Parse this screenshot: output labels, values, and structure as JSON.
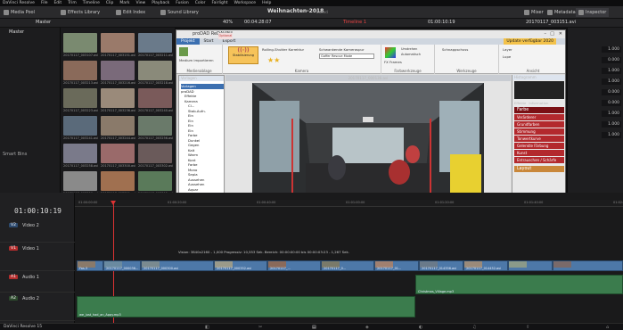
{
  "menubar": {
    "items": [
      "DaVinci Resolve",
      "File",
      "Edit",
      "Trim",
      "Timeline",
      "Clip",
      "Mark",
      "View",
      "Playback",
      "Fusion",
      "Color",
      "Fairlight",
      "Workspace",
      "Help"
    ]
  },
  "toolbar": {
    "media_pool": "Media Pool",
    "effects_library": "Effects Library",
    "edit_index": "Edit Index",
    "sound_library": "Sound Library",
    "project_title": "Weihnachten-2018",
    "edited": "Edited",
    "mixer": "Mixer",
    "metadata": "Metadata",
    "inspector": "Inspector"
  },
  "bar2": {
    "bin": "Master",
    "zoom": "40%",
    "src_tc": "00:04:28:07",
    "timeline_name": "Timeline 1",
    "rec_tc": "01:00:10:19",
    "clip_name": "20170117_003151.avi"
  },
  "library": {
    "master": "Master",
    "smart_bins": "Smart Bins"
  },
  "thumbs": [
    {
      "label": "20170117_003107.avi",
      "color": "#7a8a70"
    },
    {
      "label": "20170117_003151.avi",
      "color": "#9a7a6a"
    },
    {
      "label": "20170117_003211.avi",
      "color": "#6a7a8a"
    },
    {
      "label": "20170117_003213.avi",
      "color": "#8a6a5a"
    },
    {
      "label": "20170117_003216.avi",
      "color": "#7a6a7a"
    },
    {
      "label": "20170117_003218.avi",
      "color": "#8a8a7a"
    },
    {
      "label": "20170117_003223.avi",
      "color": "#6a6a5a"
    },
    {
      "label": "20170117_003236.avi",
      "color": "#9a8a7a"
    },
    {
      "label": "20170117_003240.avi",
      "color": "#7a5a5a"
    },
    {
      "label": "20170117_003241.avi",
      "color": "#5a6a7a"
    },
    {
      "label": "20170117_003244.avi",
      "color": "#8a7a6a"
    },
    {
      "label": "20170117_003256.avi",
      "color": "#6a7a6a"
    },
    {
      "label": "20170117_003258.avi",
      "color": "#7a7a8a"
    },
    {
      "label": "20170117_003300.avi",
      "color": "#9a6a6a"
    },
    {
      "label": "20170117_003302.avi",
      "color": "#6a5a5a"
    },
    {
      "label": "20170117_003306.avi",
      "color": "#8a8a8a"
    },
    {
      "label": "20170117_003311.avi",
      "color": "#a07050"
    },
    {
      "label": "20170117_003315.avi",
      "color": "#5a7a5a"
    }
  ],
  "window": {
    "title": "proDAD ReDAVIN°",
    "tabs": [
      "Projekt",
      "Start",
      "Export"
    ],
    "tab_badge": "Optional",
    "update": "Update verfügbar 2020",
    "ribbon_groups": [
      "Medienablage",
      "Kamera",
      "Farbwerkzeuge",
      "Werkzeuge",
      "Ansicht"
    ],
    "ribbon_items": {
      "import": "Medium importieren",
      "stab": "Stabilisierung",
      "rolling": "Rolling-Shutter Korrektur",
      "analyse": "Analyse",
      "zoom_label": "Schwankende Kameraspur",
      "zoom_value": "Gaffer Rescue Mode",
      "fx": "FX Frames",
      "umdrehen": "Umdrehen",
      "auto": "Automatisch",
      "schnappschuss": "Schnappschuss",
      "layer": "Layer",
      "lupe": "Lupe"
    },
    "left_title": "Vorlagen",
    "tree": [
      "Vorlagen",
      "proDAD",
      "Effekte",
      "Kamera",
      "Cl...",
      "Stab-Aufn.",
      "Ein",
      "Ein",
      "Ein",
      "Ein",
      "Farbe",
      "Dunkel",
      "Gegen",
      "Kalt",
      "Warm",
      "Kont",
      "Farbe",
      "Mono",
      "Sepia",
      "Aussehen",
      "Aussehen",
      "Aquar",
      "Art",
      "Coolfilm",
      "Home",
      "Hell",
      "Hellgr"
    ],
    "clip_header": "20170117_000136.avi",
    "timecode": "00:00:00:29",
    "right_title": "Histogramm",
    "right_tabs": [
      "Effekte",
      "Information"
    ],
    "fx_header": "Farbe",
    "fx_items": [
      "Verärderer",
      "Grundfarben",
      "Stimmung",
      "Tonwertkurve",
      "Gelenkte Färbung",
      "Kunst",
      "Entrauschen / Schärfe"
    ],
    "layout_header": "Layout"
  },
  "inspector": {
    "values": [
      "1.000",
      "0.000",
      "1.000",
      "1.000",
      "0.000",
      "0.000",
      "1.000",
      "1.000",
      "1.000"
    ]
  },
  "timeline": {
    "timecode": "01:00:10:19",
    "ruler": [
      "01:00:00:00",
      "01:00:20:00",
      "01:00:40:00",
      "01:01:00:00",
      "01:01:20:00",
      "01:01:40:00",
      "01:02:00:00"
    ],
    "tracks": [
      {
        "tag": "V2",
        "name": "Video 2",
        "color": "#2d4a6e"
      },
      {
        "tag": "V1",
        "name": "Video 1",
        "color": "#b32d2d"
      },
      {
        "tag": "A1",
        "name": "Audio 1",
        "color": "#b32d2d"
      },
      {
        "tag": "A2",
        "name": "Audio 2",
        "color": "#2d4a2d"
      }
    ],
    "v1_clips": [
      "Fas-3",
      "20170117_000036...",
      "20170117_000300.avi",
      "20170117_000352.avi",
      "20170117_...",
      "20170117_0...",
      "20170117_01...",
      "20170117_014356.avi",
      "20170117_014452.avi"
    ],
    "v1_meta": "Vision: 3840x2160 - 1,000 Progressiv: 10,553 Sek. Bereich: 00:00:00:00 bis 00:00:03:23 - 1,267 Sek.",
    "a1_clip": "Christmas_Village.mp3",
    "a2_clip": "we_just_had_an_Appy.mp3"
  },
  "status": {
    "app": "DaVinci Resolve 15"
  }
}
